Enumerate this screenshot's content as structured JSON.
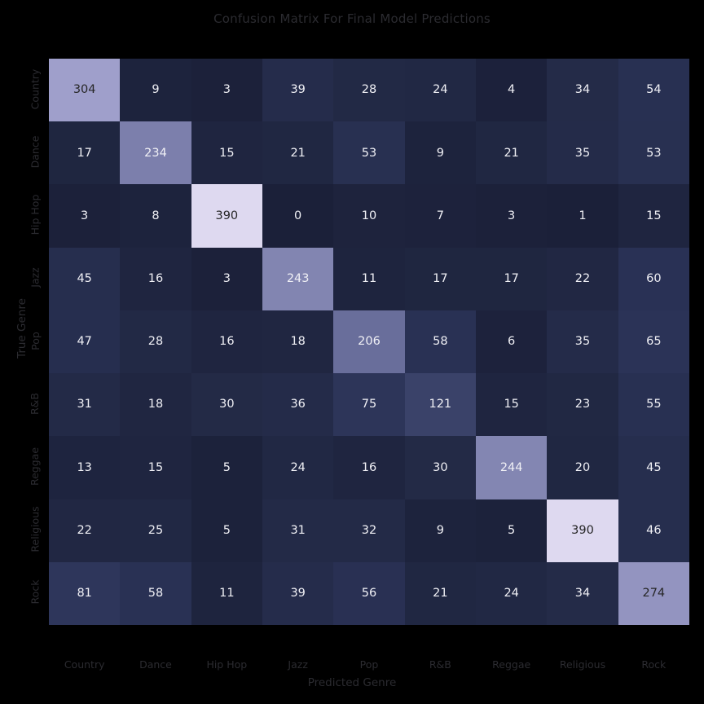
{
  "chart_data": {
    "type": "heatmap",
    "title": "Confusion Matrix For Final Model Predictions",
    "xlabel": "Predicted Genre",
    "ylabel": "True Genre",
    "categories": [
      "Country",
      "Dance",
      "Hip Hop",
      "Jazz",
      "Pop",
      "R&B",
      "Reggae",
      "Religious",
      "Rock"
    ],
    "x_tick_labels": [
      "Country",
      "Dance",
      "Hip Hop",
      "Jazz",
      "Pop",
      "R&B",
      "Reggae",
      "Religious",
      "Rock"
    ],
    "y_tick_labels": [
      "Country",
      "Dance",
      "Hip Hop",
      "Jazz",
      "Pop",
      "R&B",
      "Reggae",
      "Religious",
      "Rock"
    ],
    "annotated": true,
    "grid": false,
    "legend": "none",
    "colormap": {
      "name": "dark-purple-sequential",
      "vmin": 0,
      "vmax": 390,
      "low_color": "#1b2039",
      "mid_color": "#555b8c",
      "high_color": "#ded9f0"
    },
    "values": [
      [
        304,
        9,
        3,
        39,
        28,
        24,
        4,
        34,
        54
      ],
      [
        17,
        234,
        15,
        21,
        53,
        9,
        21,
        35,
        53
      ],
      [
        3,
        8,
        390,
        0,
        10,
        7,
        3,
        1,
        15
      ],
      [
        45,
        16,
        3,
        243,
        11,
        17,
        17,
        22,
        60
      ],
      [
        47,
        28,
        16,
        18,
        206,
        58,
        6,
        35,
        65
      ],
      [
        31,
        18,
        30,
        36,
        75,
        121,
        15,
        23,
        55
      ],
      [
        13,
        15,
        5,
        24,
        16,
        30,
        244,
        20,
        45
      ],
      [
        22,
        25,
        5,
        31,
        32,
        9,
        5,
        390,
        46
      ],
      [
        81,
        58,
        11,
        39,
        56,
        21,
        24,
        34,
        274
      ]
    ]
  },
  "figure": {
    "background_color": "#000000",
    "text_color": "#2b2b30",
    "cell_text_light": "#f0f0f5",
    "cell_text_dark": "#262626"
  }
}
